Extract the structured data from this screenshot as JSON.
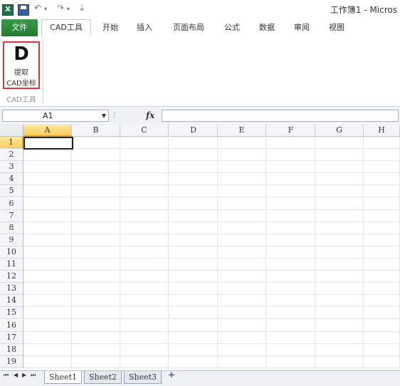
{
  "window": {
    "title": "工作簿1 - Micros"
  },
  "quick_access": {
    "undo_glyph": "↶",
    "redo_glyph": "↷",
    "dropdown_glyph": "▾",
    "customize_glyph": "⇣"
  },
  "ribbon": {
    "tabs": [
      {
        "label": "文件"
      },
      {
        "label": "CAD工具"
      },
      {
        "label": "开始"
      },
      {
        "label": "插入"
      },
      {
        "label": "页面布局"
      },
      {
        "label": "公式"
      },
      {
        "label": "数据"
      },
      {
        "label": "审阅"
      },
      {
        "label": "视图"
      }
    ],
    "active_tab": "CAD工具",
    "cad_button": {
      "glyph": "D",
      "label_line1": "提取",
      "label_line2": "CAD坐标"
    },
    "group_label": "CAD工具"
  },
  "formula_bar": {
    "name_box": "A1",
    "fx_label": "fx",
    "formula": ""
  },
  "grid": {
    "columns": [
      "A",
      "B",
      "C",
      "D",
      "E",
      "F",
      "G",
      "H"
    ],
    "rows": [
      "1",
      "2",
      "3",
      "4",
      "5",
      "6",
      "7",
      "8",
      "9",
      "10",
      "11",
      "12",
      "13",
      "14",
      "15",
      "16",
      "17",
      "18",
      "19"
    ],
    "selected_cell": "A1"
  },
  "sheets": {
    "tabs": [
      "Sheet1",
      "Sheet2",
      "Sheet3"
    ],
    "active": "Sheet1"
  },
  "colors": {
    "file_tab": "#217a31",
    "highlight_border": "#d9363e",
    "selection_header": "#f7cf5c"
  }
}
